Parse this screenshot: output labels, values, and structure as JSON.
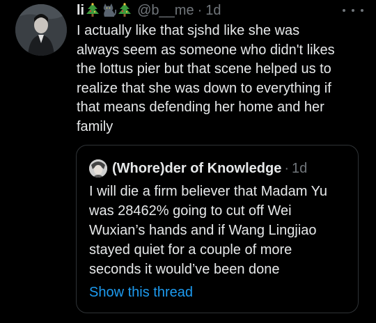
{
  "tweet": {
    "display_name": "li",
    "handle": "@b__me",
    "separator": "·",
    "time": "1d",
    "emojis": [
      "christmas-tree",
      "black-cat",
      "christmas-tree"
    ],
    "text_lines": [
      "I actually like that sjshd like she was",
      "always seem as someone who didn't likes",
      "the lottus pier but that scene helped us to",
      "realize that she was down to everything if",
      "that means defending her home and her",
      "family"
    ]
  },
  "quoted": {
    "display_name": "(Whore)der of Knowledge",
    "separator": "·",
    "time": "1d",
    "text_lines": [
      "I will die a firm believer that Madam Yu",
      "was 28462% going to cut off Wei",
      "Wuxian’s hands and if Wang Lingjiao",
      "stayed quiet for a couple of more",
      "seconds it would’ve been done"
    ],
    "show_thread_label": "Show this thread"
  },
  "colors": {
    "background": "#000000",
    "text": "#e7e9ea",
    "muted": "#71767b",
    "link": "#1d9bf0",
    "border": "#2f3336"
  },
  "icons": {
    "more": "more-horizontal-icon"
  }
}
